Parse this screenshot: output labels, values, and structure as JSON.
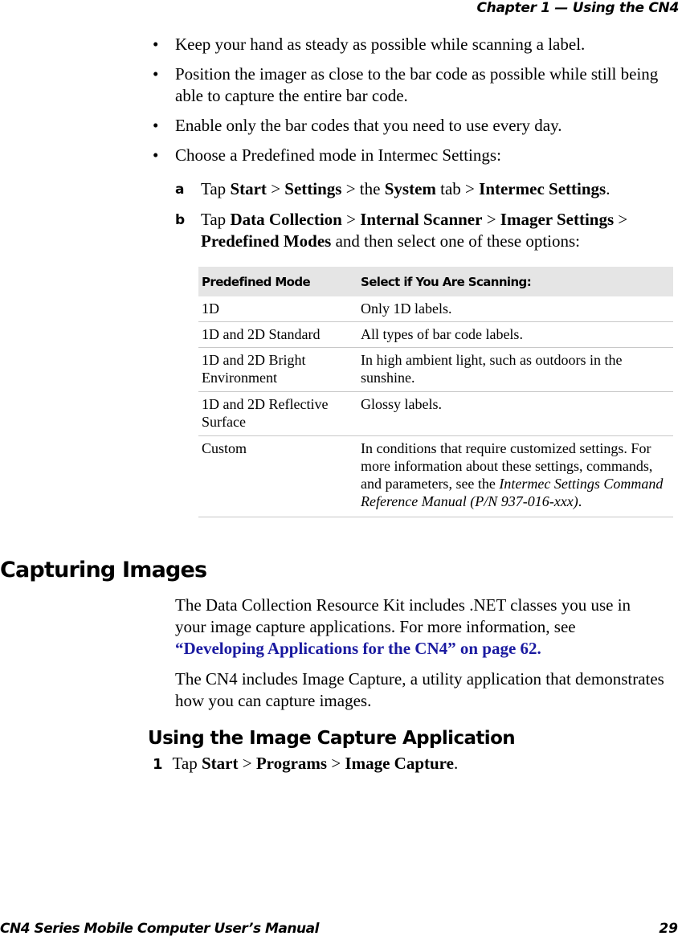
{
  "header": {
    "chapter": "Chapter 1 — Using the CN4"
  },
  "footer": {
    "title": "CN4 Series Mobile Computer User’s Manual",
    "page": "29"
  },
  "bullets": [
    "Keep your hand as steady as possible while scanning a label.",
    "Position the imager as close to the bar code as possible while still being able to capture the entire bar code.",
    "Enable only the bar codes that you need to use every day.",
    "Choose a Predefined mode in Intermec Settings:"
  ],
  "bullet_symbol": "•",
  "steps_predefined": {
    "a": {
      "marker": "a",
      "tap": "Tap ",
      "start": "Start",
      "sep": " > ",
      "settings": "Settings",
      "the": " > the ",
      "system": "System",
      "tab": " tab > ",
      "intermec_settings": "Intermec Settings",
      "end": "."
    },
    "b": {
      "marker": "b",
      "tap": "Tap ",
      "data_collection": "Data Collection",
      "sep": " > ",
      "internal_scanner": "Internal Scanner",
      "imager_settings": "Imager Settings",
      "sep_end": " > ",
      "predefined_modes": "Predefined Modes",
      "rest": " and then select one of these options:"
    }
  },
  "modes_table": {
    "headers": [
      "Predefined Mode",
      "Select if You Are Scanning:"
    ],
    "rows": [
      {
        "mode": "1D",
        "description": "Only 1D labels."
      },
      {
        "mode": "1D and 2D Standard",
        "description": "All types of bar code labels."
      },
      {
        "mode": "1D and 2D Bright Environment",
        "description": "In high ambient light, such as outdoors in the sunshine."
      },
      {
        "mode": "1D and 2D Reflective Surface",
        "description": "Glossy labels."
      },
      {
        "mode": "Custom",
        "description": "In conditions that require customized settings. For more information about these settings, commands, and parameters, see the ",
        "ref_title": "Intermec Settings Command Reference Manual (P/N 937-016-xxx)",
        "end": "."
      }
    ]
  },
  "capturing": {
    "heading": "Capturing Images",
    "para1": "The Data Collection Resource Kit includes .NET classes you use in your image capture applications. For more information, see ",
    "xref": "“Developing Applications for the CN4” on page 62.",
    "para2": "The CN4 includes Image Capture, a utility application that demonstrates how you can capture images."
  },
  "image_capture_app": {
    "heading": "Using the Image Capture Application",
    "step1": {
      "num": "1",
      "tap": "Tap ",
      "start": "Start",
      "sep": " > ",
      "programs": "Programs",
      "image_capture": "Image Capture",
      "end": "."
    }
  },
  "colors": {
    "link": "#1a1aa0",
    "table_header_bg": "#e5e5e5",
    "rule": "#c8c8c8"
  }
}
